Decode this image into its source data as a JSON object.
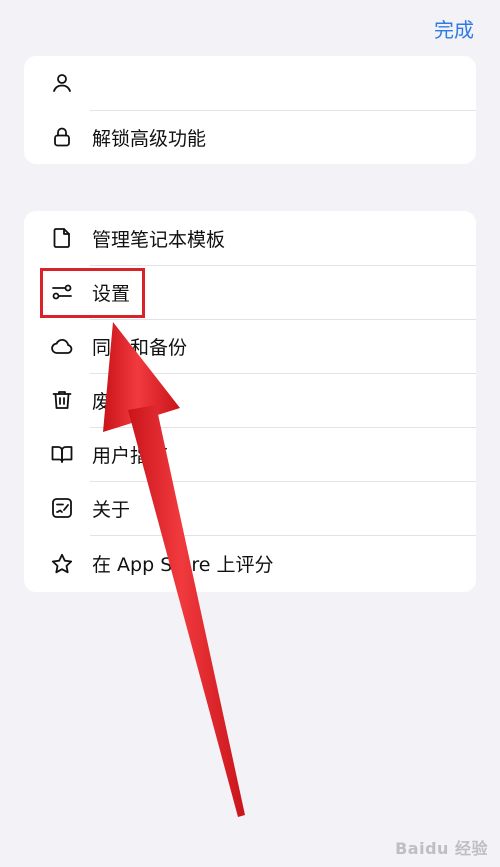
{
  "header": {
    "done_label": "完成"
  },
  "top_group": {
    "items": [
      {
        "icon": "person-icon",
        "label": ""
      },
      {
        "icon": "lock-icon",
        "label": "解锁高级功能"
      }
    ]
  },
  "main_group": {
    "items": [
      {
        "icon": "document-icon",
        "label": "管理笔记本模板"
      },
      {
        "icon": "sliders-icon",
        "label": "设置"
      },
      {
        "icon": "cloud-icon",
        "label": "同步和备份"
      },
      {
        "icon": "trash-icon",
        "label": "废纸篓"
      },
      {
        "icon": "book-icon",
        "label": "用户指南"
      },
      {
        "icon": "note-edit-icon",
        "label": "关于"
      },
      {
        "icon": "star-icon",
        "label": "在 App Store 上评分"
      }
    ]
  },
  "annotation": {
    "highlight_color": "#d8232a",
    "arrow_color": "#e8262a"
  },
  "watermark": {
    "text": "Baidu 经验"
  },
  "colors": {
    "accent": "#2f7be6",
    "background": "#f2f2f7",
    "card": "#ffffff"
  }
}
